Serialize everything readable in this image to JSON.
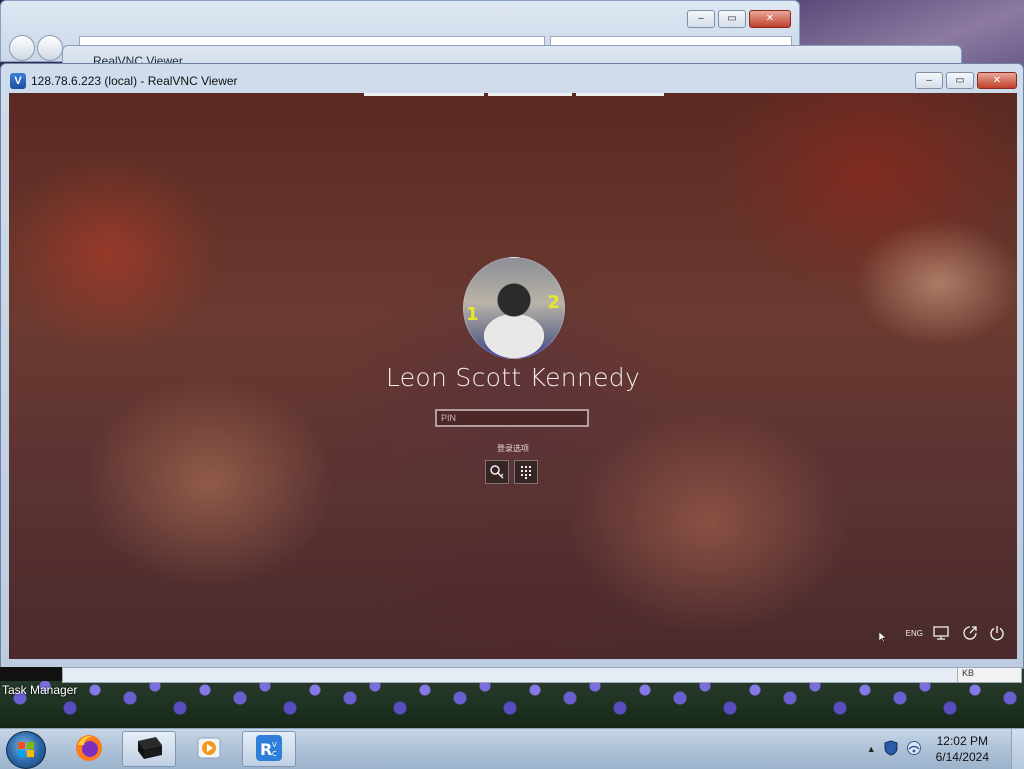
{
  "background_windows": [
    {
      "title": "",
      "address": "",
      "search": ""
    },
    {
      "title": "RealVNC Viewer"
    }
  ],
  "vnc_window": {
    "title": "128.78.6.223 (local) - RealVNC Viewer",
    "app_icon": "vnc-icon"
  },
  "lock_screen": {
    "user_name": "Leon Scott Kennedy",
    "pin_placeholder": "PIN",
    "signin_options_label": "登录选项",
    "avatar_numbers": [
      "1",
      "2"
    ],
    "tray_language": "ENG",
    "options": [
      "key-icon",
      "keypad-icon"
    ]
  },
  "lower": {
    "task_manager_label": "Task Manager",
    "scroll_label": "KB"
  },
  "taskbar": {
    "items": [
      "firefox-icon",
      "terminal-icon",
      "media-player-icon",
      "realvnc-icon"
    ],
    "clock_time": "12:02 PM",
    "clock_date": "6/14/2024"
  },
  "colors": {
    "accent": "#3c7ed6",
    "close_button": "#c0402a",
    "taskbar": "#aec2d8"
  }
}
